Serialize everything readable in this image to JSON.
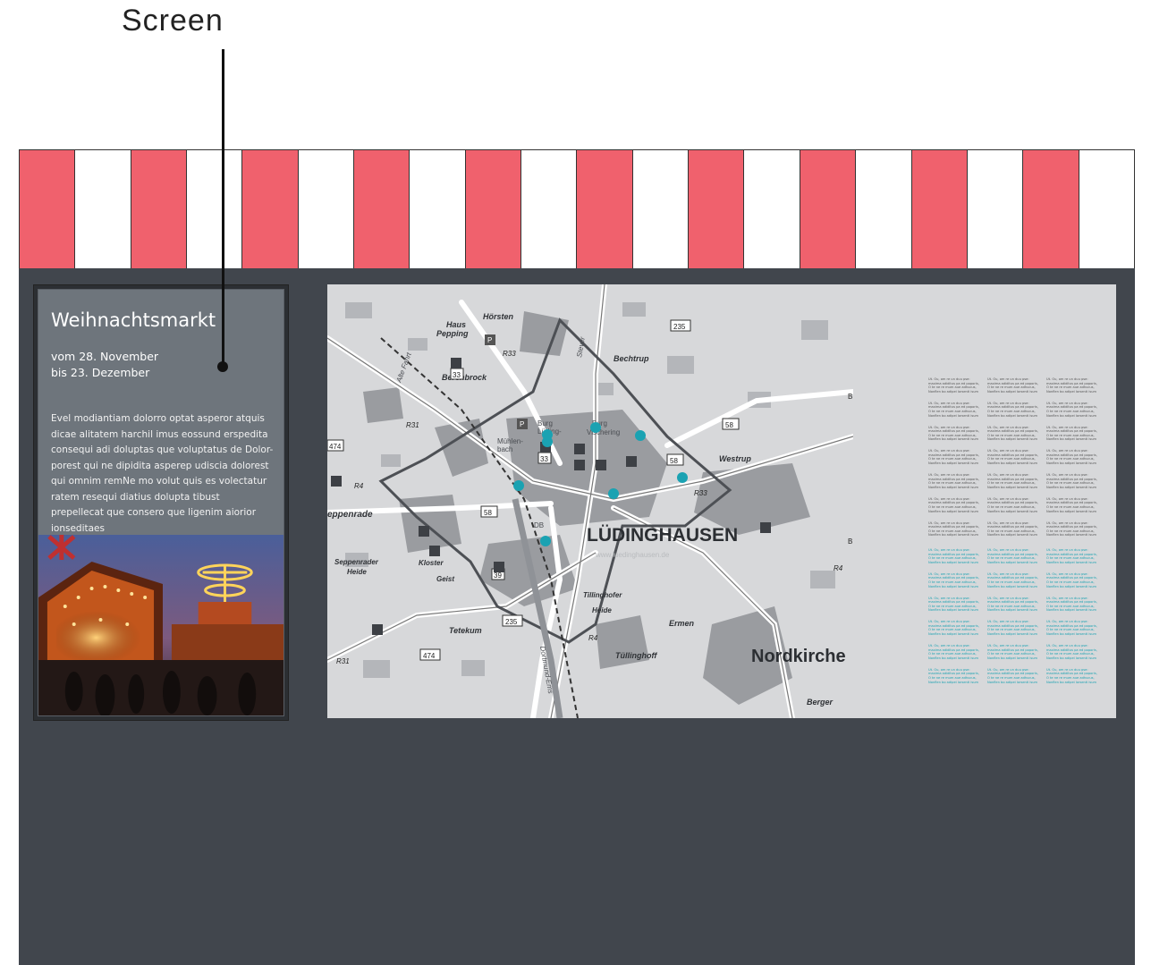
{
  "annotation": {
    "label": "Screen"
  },
  "screen": {
    "title": "Weihnachtsmarkt",
    "date_line1": "vom 28. November",
    "date_line2": "bis 23. Dezember",
    "body": "Evel modiantiam dolorro optat asperor atquis dicae alitatem harchil imus eossund erspedita consequi adi doluptas que voluptatus de Dolor-porest qui ne dipidita asperep udiscia dolorest qui omnim remNe mo volut quis es volectatur ratem resequi diatius dolupta tibust prepellecat que consero que ligenim aiorior ionseditaes"
  },
  "colors": {
    "awning_red": "#f0616d",
    "booth": "#41464d",
    "marker": "#1aa2b2",
    "map_bg": "#d7d8da"
  },
  "map": {
    "labels": {
      "city": "LÜDINGHAUSEN",
      "nordkirchen": "Nordkirche",
      "berenbrock": "Berenbrock",
      "haus_pepping": "Haus",
      "haus_pepping2": "Pepping",
      "horsten": "Hörsten",
      "bechtrup": "Bechtrup",
      "westrup": "Westrup",
      "seppenrade": "eppenrade",
      "seppenrader_heide": "Seppenrader",
      "seppenrader_heide2": "Heide",
      "kloster": "Kloster",
      "geist": "Geist",
      "tetekum": "Tetekum",
      "tuellinghoff": "Tüllinghoff",
      "tuellinghofer_heide": "Tillinghofer",
      "tuellinghofer_heide2": "Heide",
      "ermen": "Ermen",
      "berger": "Berger",
      "burg_luedinghausen": "Burg",
      "burg_luedinghausen2": "Lüding-",
      "burg_vischering": "Burg",
      "burg_vischering2": "Vischering",
      "muehlenbach": "Mühlen-",
      "muehlenbach2": "bach",
      "alte_fahrt": "Alte Fahrt",
      "dortmund_ems": "Dortmund-Ems",
      "stever": "Stever",
      "db": "DB",
      "watermark": "www.luedinghausen.de"
    },
    "road_numbers": [
      "235",
      "58",
      "58",
      "58",
      "474",
      "474",
      "235",
      "R33",
      "R31",
      "R4",
      "R4",
      "R4",
      "R31",
      "R33",
      "33",
      "33",
      "39",
      "B",
      "B",
      "P",
      "P"
    ],
    "markers": 8
  },
  "info_text": {
    "paragraph": "Ut. Ou, om re un duu pse: maxima adiditus pa ed poporis, O te ne re mum aue adhucus, Nonflen bo adipei lorsenti isum",
    "columns": 3,
    "gray_paragraphs": 7,
    "teal_paragraphs": 6
  }
}
